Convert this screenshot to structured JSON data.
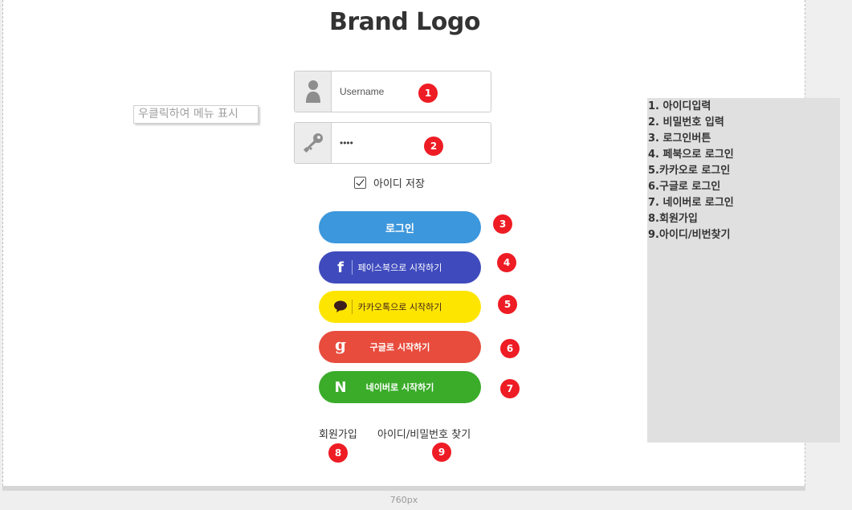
{
  "brand": {
    "title": "Brand Logo"
  },
  "context_hint": "우클릭하여 메뉴 표시",
  "username": {
    "placeholder": "Username",
    "value": ""
  },
  "password": {
    "value": "1234"
  },
  "remember": {
    "label": "아이디 저장",
    "checked": true
  },
  "buttons": {
    "login": "로그인",
    "facebook": "페이스북으로 시작하기",
    "kakao": "카카오톡으로 시작하기",
    "google": "구글로 시작하기",
    "naver": "네이버로 시작하기",
    "facebook_glyph": "f",
    "google_glyph": "g",
    "naver_glyph": "N"
  },
  "links": {
    "signup": "회원가입",
    "find": "아이디/비밀번호 찾기"
  },
  "badges": [
    "1",
    "2",
    "3",
    "4",
    "5",
    "6",
    "7",
    "8",
    "9"
  ],
  "notes": [
    "1. 아이디입력",
    "2. 비밀번호 입력",
    "3. 로그인버튼",
    "4. 페북으로 로그인",
    "5.카카오로 로그인",
    "6.구글로 로그인",
    "7. 네이버로 로그인",
    "8.회원가입",
    "9.아이디/비번찾기"
  ],
  "canvas_width_label": "760px",
  "icons": {
    "username": "user-icon",
    "password": "key-icon",
    "kakao": "speech-bubble-icon"
  },
  "colors": {
    "login": "#3c97dc",
    "facebook": "#3f4bbd",
    "kakao": "#fee500",
    "google": "#e84c3d",
    "naver": "#3aac2a",
    "badge": "#ee1c24"
  }
}
